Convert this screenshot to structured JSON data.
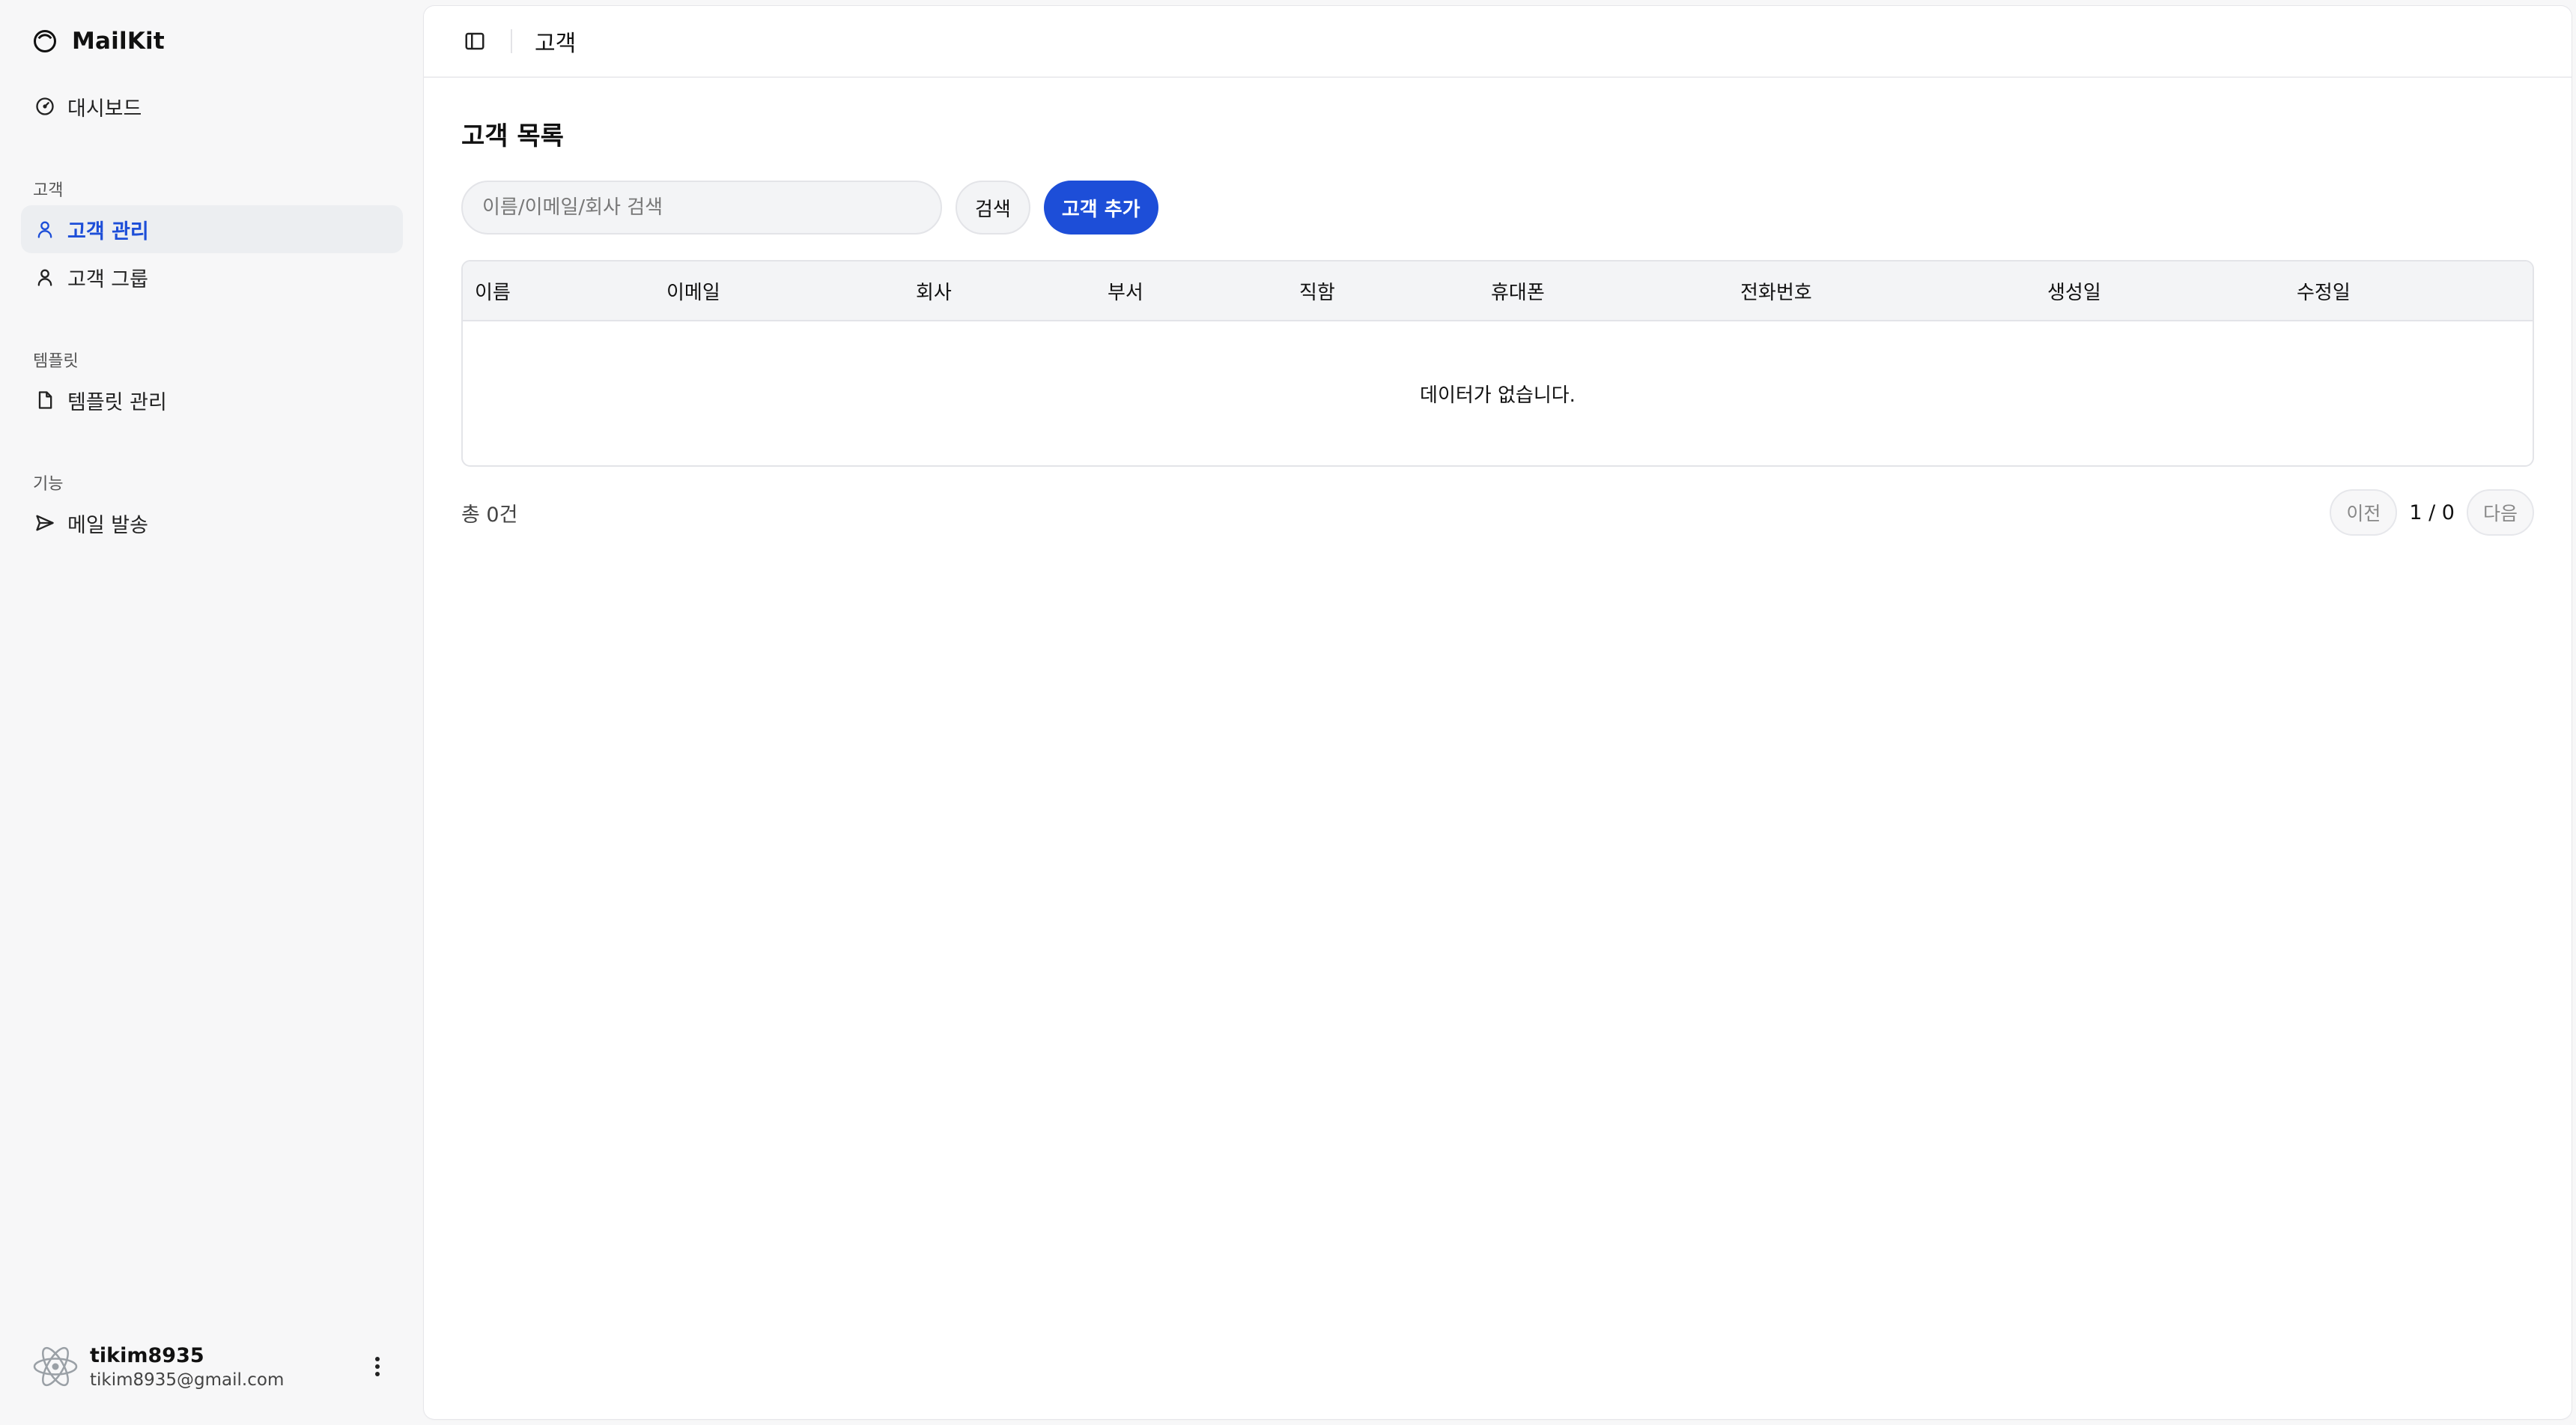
{
  "brand": {
    "name": "MailKit",
    "logo_icon": "circle-logo-icon"
  },
  "sidebar": {
    "dashboard": {
      "label": "대시보드",
      "icon": "dashboard-gauge-icon"
    },
    "sections": [
      {
        "label": "고객",
        "items": [
          {
            "label": "고객 관리",
            "icon": "user-icon",
            "active": true
          },
          {
            "label": "고객 그룹",
            "icon": "user-icon",
            "active": false
          }
        ]
      },
      {
        "label": "템플릿",
        "items": [
          {
            "label": "템플릿 관리",
            "icon": "file-icon",
            "active": false
          }
        ]
      },
      {
        "label": "기능",
        "items": [
          {
            "label": "메일 발송",
            "icon": "send-icon",
            "active": false
          }
        ]
      }
    ],
    "user": {
      "name": "tikim8935",
      "email": "tikim8935@gmail.com",
      "avatar_icon": "react-atom-icon"
    }
  },
  "topbar": {
    "title": "고객",
    "toggle_icon": "sidebar-toggle-icon"
  },
  "page": {
    "title": "고객 목록",
    "search": {
      "placeholder": "이름/이메일/회사 검색",
      "value": ""
    },
    "search_button": "검색",
    "add_button": "고객 추가",
    "table": {
      "columns": [
        "이름",
        "이메일",
        "회사",
        "부서",
        "직함",
        "휴대폰",
        "전화번호",
        "생성일",
        "수정일"
      ],
      "rows": [],
      "empty_text": "데이터가 없습니다."
    },
    "total_text": "총 0건",
    "pagination": {
      "prev": "이전",
      "info": "1 / 0",
      "next": "다음"
    }
  },
  "colors": {
    "accent": "#1d4ed8",
    "sidebar_bg": "#f7f7f8",
    "active_bg": "#eceef1"
  }
}
